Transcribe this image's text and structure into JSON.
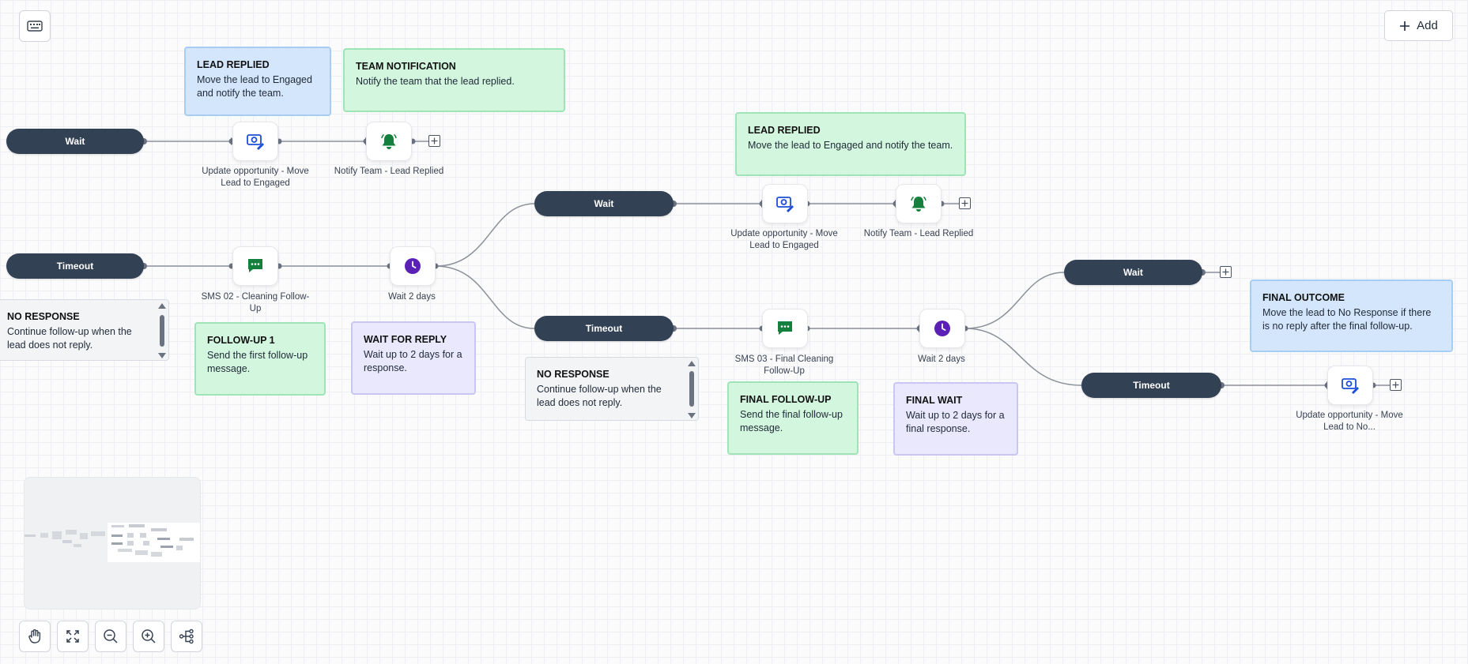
{
  "toolbar": {
    "add_label": "Add",
    "keyboard_icon": "keyboard-icon",
    "plus_icon": "plus-icon"
  },
  "colors": {
    "pill": "#334155",
    "sms": "#15803d",
    "bell": "#15803d",
    "clock": "#5b21b6",
    "opportunity": "#1d4ed8"
  },
  "pills": {
    "wait1": "Wait",
    "timeout1": "Timeout",
    "wait2": "Wait",
    "timeout2": "Timeout",
    "wait3": "Wait",
    "timeout3": "Timeout"
  },
  "nodes": {
    "upd1": "Update opportunity - Move Lead to Engaged",
    "notify1": "Notify Team - Lead Replied",
    "sms02": "SMS 02 - Cleaning Follow-Up",
    "wait2days1": "Wait 2 days",
    "upd2": "Update opportunity - Move Lead to Engaged",
    "notify2": "Notify Team - Lead Replied",
    "sms03": "SMS 03 - Final Cleaning Follow-Up",
    "wait2days2": "Wait 2 days",
    "upd3": "Update opportunity - Move Lead to No..."
  },
  "notes": {
    "lead_replied_1": {
      "title": "LEAD REPLIED",
      "body": "Move the lead to Engaged and notify the team."
    },
    "team_notification": {
      "title": "TEAM NOTIFICATION",
      "body": "Notify the team that the lead replied."
    },
    "lead_replied_2": {
      "title": "LEAD REPLIED",
      "body": "Move the lead to Engaged and notify the team."
    },
    "no_response_1": {
      "title": "NO RESPONSE",
      "body": "Continue follow-up when the lead does not reply."
    },
    "followup1": {
      "title": "FOLLOW-UP 1",
      "body": "Send the first follow-up message."
    },
    "wait_for_reply": {
      "title": "WAIT FOR REPLY",
      "body": "Wait up to 2 days for a response."
    },
    "no_response_2": {
      "title": "NO RESPONSE",
      "body": "Continue follow-up when the lead does not reply."
    },
    "final_followup": {
      "title": "FINAL FOLLOW-UP",
      "body": "Send the final follow-up message."
    },
    "final_wait": {
      "title": "FINAL WAIT",
      "body": "Wait up to 2 days for a final response."
    },
    "final_outcome": {
      "title": "FINAL OUTCOME",
      "body": "Move the lead to No Response if there is no reply after the final follow-up."
    }
  },
  "controls": {
    "pan": "hand-icon",
    "fit": "fit-view-icon",
    "zoom_out": "zoom-out-icon",
    "zoom_in": "zoom-in-icon",
    "layout": "auto-layout-icon"
  }
}
